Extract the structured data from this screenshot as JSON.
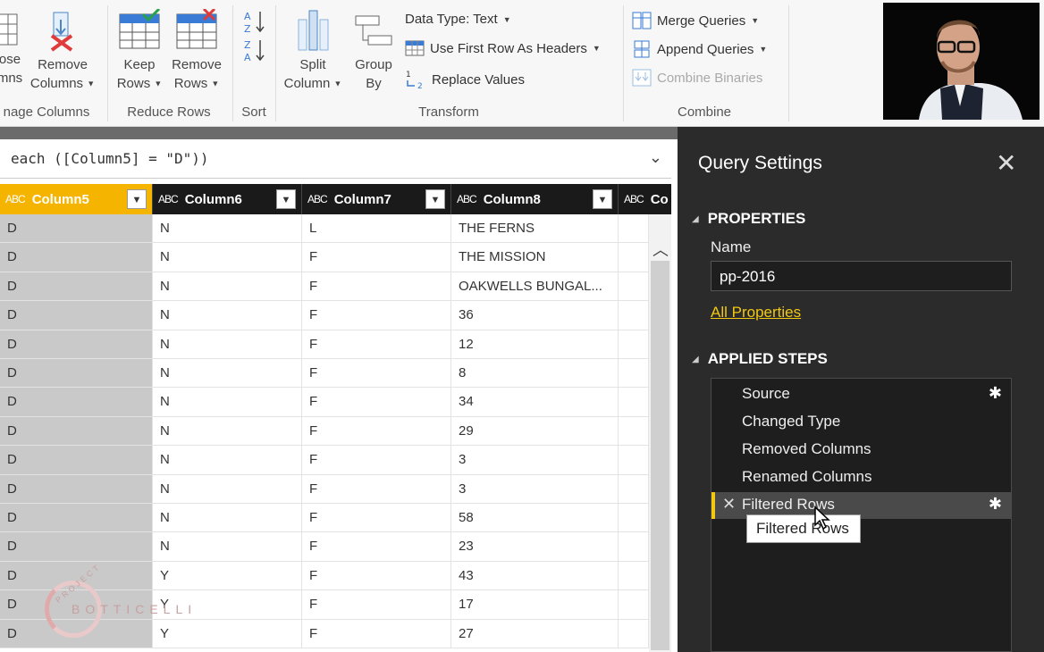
{
  "ribbon": {
    "choose_columns": {
      "line1": "ose",
      "line2": "mns"
    },
    "remove_columns": {
      "line1": "Remove",
      "line2": "Columns"
    },
    "keep_rows": {
      "line1": "Keep",
      "line2": "Rows"
    },
    "remove_rows": {
      "line1": "Remove",
      "line2": "Rows"
    },
    "split_column": {
      "line1": "Split",
      "line2": "Column"
    },
    "group_by": {
      "line1": "Group",
      "line2": "By"
    },
    "data_type": "Data Type: Text",
    "use_first_row": "Use First Row As Headers",
    "replace_values": "Replace Values",
    "merge_queries": "Merge Queries",
    "append_queries": "Append Queries",
    "combine_binaries": "Combine Binaries",
    "groups": {
      "manage_columns": "nage Columns",
      "reduce_rows": "Reduce Rows",
      "sort": "Sort",
      "transform": "Transform",
      "combine": "Combine"
    }
  },
  "formula": {
    "text": "each ([Column5] = \"D\"))"
  },
  "grid": {
    "type_label": "ABC",
    "columns": [
      "Column5",
      "Column6",
      "Column7",
      "Column8",
      "Co"
    ],
    "rows": [
      [
        "D",
        "N",
        "L",
        "THE FERNS"
      ],
      [
        "D",
        "N",
        "F",
        "THE MISSION"
      ],
      [
        "D",
        "N",
        "F",
        "OAKWELLS BUNGAL..."
      ],
      [
        "D",
        "N",
        "F",
        "36"
      ],
      [
        "D",
        "N",
        "F",
        "12"
      ],
      [
        "D",
        "N",
        "F",
        "8"
      ],
      [
        "D",
        "N",
        "F",
        "34"
      ],
      [
        "D",
        "N",
        "F",
        "29"
      ],
      [
        "D",
        "N",
        "F",
        "3"
      ],
      [
        "D",
        "N",
        "F",
        "3"
      ],
      [
        "D",
        "N",
        "F",
        "58"
      ],
      [
        "D",
        "N",
        "F",
        "23"
      ],
      [
        "D",
        "Y",
        "F",
        "43"
      ],
      [
        "D",
        "Y",
        "F",
        "17"
      ],
      [
        "D",
        "Y",
        "F",
        "27"
      ]
    ]
  },
  "watermark": {
    "text": "BOTTICELLI",
    "sub": "PROJECT"
  },
  "query_settings": {
    "title": "Query Settings",
    "properties_heading": "PROPERTIES",
    "name_label": "Name",
    "name_value": "pp-2016",
    "all_properties": "All Properties",
    "applied_steps_heading": "APPLIED STEPS",
    "steps": [
      "Source",
      "Changed Type",
      "Removed Columns",
      "Renamed Columns",
      "Filtered Rows"
    ],
    "tooltip": "Filtered Rows"
  },
  "colors": {
    "accent": "#f5b400",
    "panel": "#2b2b2b",
    "link": "#f2c811"
  }
}
